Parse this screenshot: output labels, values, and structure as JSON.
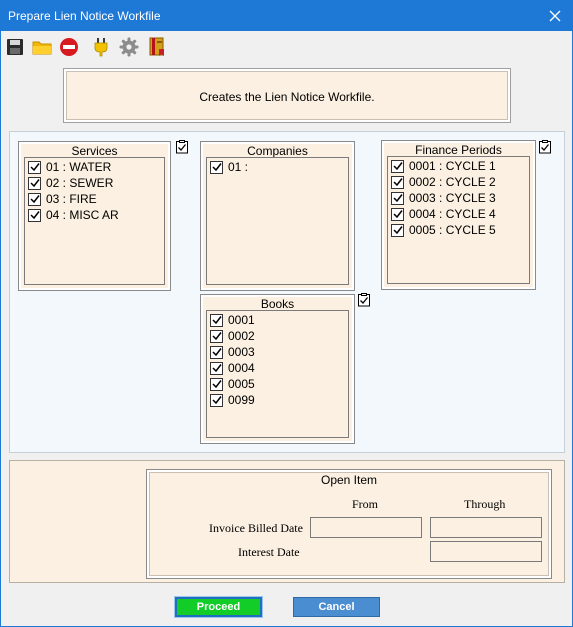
{
  "window": {
    "title": "Prepare Lien Notice Workfile"
  },
  "toolbar": {
    "icons": [
      "save-icon",
      "open-folder-icon",
      "stop-icon",
      "plug-icon",
      "gear-icon",
      "book-icon"
    ]
  },
  "description": "Creates the Lien Notice Workfile.",
  "services": {
    "title": "Services",
    "items": [
      "01 : WATER",
      "02 : SEWER",
      "03 : FIRE",
      "04 : MISC AR"
    ]
  },
  "companies": {
    "title": "Companies",
    "items": [
      "01 :"
    ]
  },
  "finance_periods": {
    "title": "Finance Periods",
    "items": [
      "0001 : CYCLE 1",
      "0002 : CYCLE 2",
      "0003 : CYCLE 3",
      "0004 : CYCLE 4",
      "0005 : CYCLE 5"
    ]
  },
  "books": {
    "title": "Books",
    "items": [
      "0001",
      "0002",
      "0003",
      "0004",
      "0005",
      "0099"
    ]
  },
  "open_item": {
    "title": "Open Item",
    "from_label": "From",
    "through_label": "Through",
    "invoice_billed_date_label": "Invoice Billed Date",
    "interest_date_label": "Interest Date",
    "invoice_billed_from": "",
    "invoice_billed_through": "",
    "interest_date_through": ""
  },
  "buttons": {
    "proceed": "Proceed",
    "cancel": "Cancel"
  },
  "colors": {
    "titlebar": "#1e78d6",
    "panel_tan": "#fbf0e1",
    "proceed": "#12cc28",
    "cancel": "#4a8dd0"
  }
}
